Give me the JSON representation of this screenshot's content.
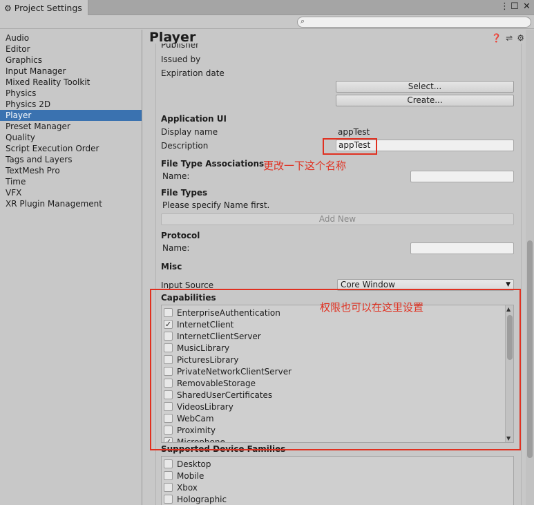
{
  "window": {
    "tab_title": "Project Settings",
    "more_icon": "more-vert-icon",
    "maximize_icon": "maximize-icon",
    "close_icon": "close-icon"
  },
  "search": {
    "placeholder": "",
    "icon": "search-icon"
  },
  "nav": {
    "items": [
      "Audio",
      "Editor",
      "Graphics",
      "Input Manager",
      "Mixed Reality Toolkit",
      "Physics",
      "Physics 2D",
      "Player",
      "Preset Manager",
      "Quality",
      "Script Execution Order",
      "Tags and Layers",
      "TextMesh Pro",
      "Time",
      "VFX",
      "XR Plugin Management"
    ],
    "selected": "Player"
  },
  "panel": {
    "title": "Player",
    "icons": [
      "help-icon",
      "preset-icon",
      "gear-icon"
    ],
    "publisher_label": "Publisher",
    "issued_by": "Issued by",
    "expiration_date": "Expiration date",
    "select_button": "Select...",
    "create_button": "Create...",
    "application_ui": {
      "header": "Application UI",
      "display_name_label": "Display name",
      "display_name_value": "appTest",
      "description_label": "Description",
      "description_value": "appTest"
    },
    "file_type_associations": {
      "header": "File Type Associations",
      "name_label": "Name:"
    },
    "file_types": {
      "header": "File Types",
      "hint": "Please specify Name first.",
      "add_new": "Add New"
    },
    "protocol": {
      "header": "Protocol",
      "name_label": "Name:"
    },
    "misc": {
      "header": "Misc",
      "input_source_label": "Input Source",
      "input_source_value": "Core Window"
    },
    "capabilities": {
      "header": "Capabilities",
      "items": [
        {
          "label": "EnterpriseAuthentication",
          "checked": false
        },
        {
          "label": "InternetClient",
          "checked": true
        },
        {
          "label": "InternetClientServer",
          "checked": false
        },
        {
          "label": "MusicLibrary",
          "checked": false
        },
        {
          "label": "PicturesLibrary",
          "checked": false
        },
        {
          "label": "PrivateNetworkClientServer",
          "checked": false
        },
        {
          "label": "RemovableStorage",
          "checked": false
        },
        {
          "label": "SharedUserCertificates",
          "checked": false
        },
        {
          "label": "VideosLibrary",
          "checked": false
        },
        {
          "label": "WebCam",
          "checked": false
        },
        {
          "label": "Proximity",
          "checked": false
        },
        {
          "label": "Microphone",
          "checked": true
        }
      ]
    },
    "supported_device_families": {
      "header": "Supported Device Families",
      "items": [
        {
          "label": "Desktop",
          "checked": false
        },
        {
          "label": "Mobile",
          "checked": false
        },
        {
          "label": "Xbox",
          "checked": false
        },
        {
          "label": "Holographic",
          "checked": false
        }
      ]
    }
  },
  "annotations": {
    "rename_note": "更改一下这个名称",
    "capabilities_note": "权限也可以在这里设置",
    "accent_color": "#e03020"
  }
}
